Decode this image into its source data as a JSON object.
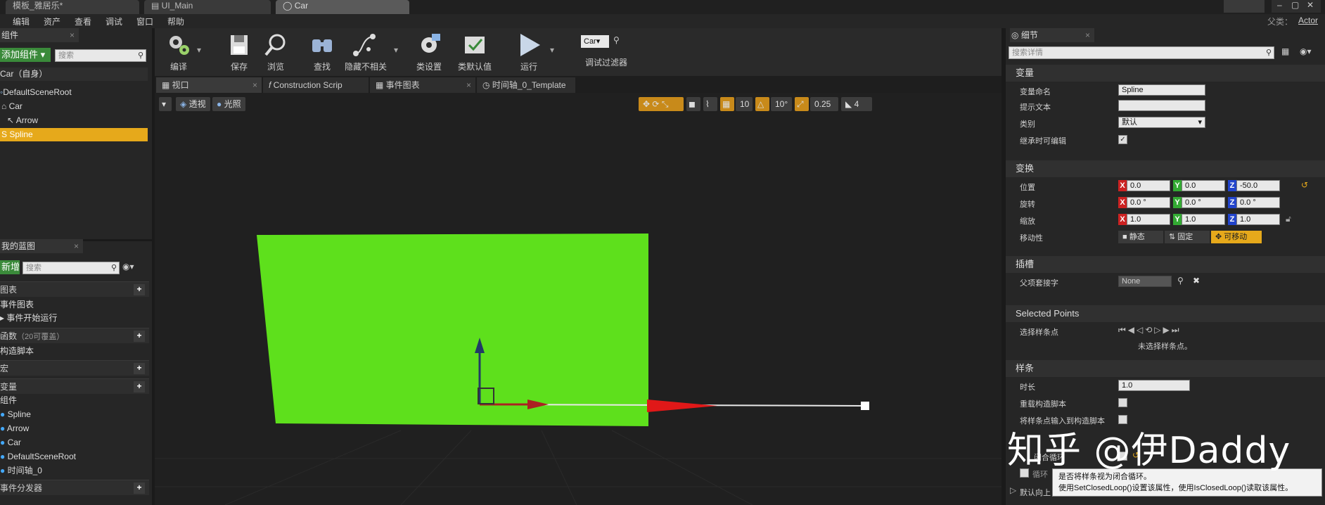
{
  "title_tabs": [
    "模板_雅居乐*",
    "UI_Main",
    "Car"
  ],
  "menu": [
    "编辑",
    "资产",
    "查看",
    "调试",
    "窗口",
    "帮助"
  ],
  "parent_class": {
    "label": "父类：",
    "value": "Actor"
  },
  "components_panel": {
    "tab": "组件",
    "add_button": "添加组件",
    "search_placeholder": "搜索",
    "self_label": "Car（自身）",
    "tree": [
      "DefaultSceneRoot",
      "Car",
      "Arrow",
      "Spline"
    ]
  },
  "blueprint_panel": {
    "tab": "我的蓝图",
    "add_button": "新增",
    "search_placeholder": "搜索",
    "graph_section": "图表",
    "graph_items": [
      "事件图表",
      "事件开始运行"
    ],
    "functions_section": "函数",
    "functions_override": "（20可覆盖）",
    "function_items": [
      "构造脚本"
    ],
    "macros_section": "宏",
    "variables_section": "变量",
    "variable_group": "组件",
    "variable_items": [
      "Spline",
      "Arrow",
      "Car",
      "DefaultSceneRoot",
      "时间轴_0"
    ],
    "dispatchers_section": "事件分发器"
  },
  "toolbar": {
    "compile": "编译",
    "save": "保存",
    "browse": "浏览",
    "find": "查找",
    "hide_unrelated": "隐藏不相关",
    "class_settings": "类设置",
    "class_defaults": "类默认值",
    "play": "运行",
    "debug_object": "Car",
    "debug_filter": "调试过滤器"
  },
  "doc_tabs": [
    "视口",
    "Construction Scrip",
    "事件图表",
    "时间轴_0_Template"
  ],
  "viewport": {
    "perspective": "透视",
    "lit": "光照",
    "grid_snap": "10",
    "rot_snap": "10°",
    "scale_snap": "0.25",
    "cam_speed": "4"
  },
  "details": {
    "tab": "细节",
    "search_placeholder": "搜索详情",
    "variable_section": "变量",
    "var_name_label": "变量命名",
    "var_name": "Spline",
    "tooltip_label": "提示文本",
    "tooltip_value": "",
    "category_label": "类别",
    "category": "默认",
    "editable_label": "继承时可编辑",
    "transform_section": "变换",
    "location_label": "位置",
    "location": [
      "0.0",
      "0.0",
      "-50.0"
    ],
    "rotation_label": "旋转",
    "rotation": [
      "0.0 °",
      "0.0 °",
      "0.0 °"
    ],
    "scale_label": "缩放",
    "scale": [
      "1.0",
      "1.0",
      "1.0"
    ],
    "mobility_label": "移动性",
    "mobility": [
      "静态",
      "固定",
      "可移动"
    ],
    "sockets_section": "插槽",
    "parent_socket_label": "父项套接字",
    "parent_socket": "None",
    "selected_points_section": "Selected Points",
    "select_points_label": "选择样条点",
    "no_points": "未选择样条点。",
    "spline_section": "样条",
    "duration_label": "时长",
    "duration": "1.0",
    "override_label": "重载构造脚本",
    "input_label": "将样条点输入到构造脚本",
    "closed_loop_label": "闭合循环",
    "loop_label": "循环",
    "default_up_label": "默认向上"
  },
  "tooltip": [
    "是否将样条视为闭合循环。",
    "使用SetClosedLoop()设置该属性，使用IsClosedLoop()读取该属性。"
  ],
  "watermark": "知乎 @伊Daddy",
  "colors": {
    "selection": "#e6a91b",
    "plane": "#5ee01c",
    "add_green": "#3a8a3a"
  }
}
